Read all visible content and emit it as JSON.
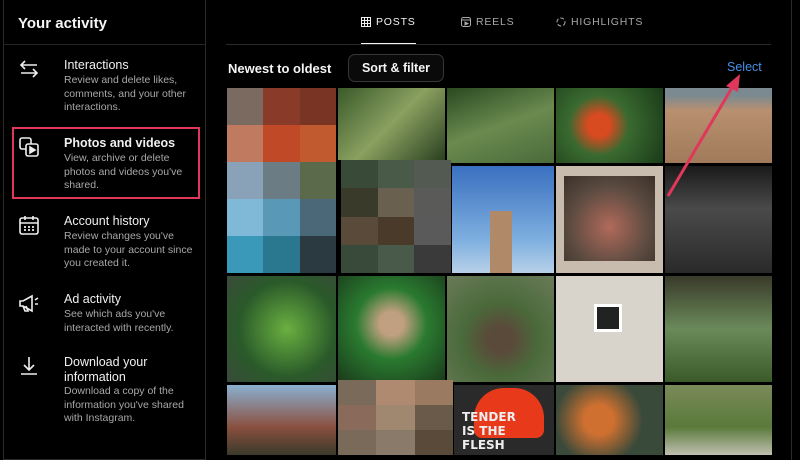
{
  "sidebar": {
    "title": "Your activity",
    "items": [
      {
        "label": "Interactions",
        "desc": "Review and delete likes, comments, and your other interactions.",
        "icon": "arrows-swap-icon"
      },
      {
        "label": "Photos and videos",
        "desc": "View, archive or delete photos and videos you've shared.",
        "icon": "photos-videos-icon"
      },
      {
        "label": "Account history",
        "desc": "Review changes you've made to your account since you created it.",
        "icon": "calendar-icon"
      },
      {
        "label": "Ad activity",
        "desc": "See which ads you've interacted with recently.",
        "icon": "megaphone-icon"
      },
      {
        "label": "Download your information",
        "desc": "Download a copy of the information you've shared with Instagram.",
        "icon": "download-icon"
      }
    ]
  },
  "tabs": [
    {
      "label": "POSTS",
      "icon": "grid-icon"
    },
    {
      "label": "REELS",
      "icon": "reels-icon"
    },
    {
      "label": "HIGHLIGHTS",
      "icon": "highlights-icon"
    }
  ],
  "toolbar": {
    "sort_label": "Newest to oldest",
    "sort_button": "Sort & filter",
    "select": "Select"
  },
  "posts": {
    "tender_text": "TENDER IS THE FLESH"
  },
  "colors": {
    "highlight": "#e0385a",
    "link": "#4a8fe7"
  }
}
